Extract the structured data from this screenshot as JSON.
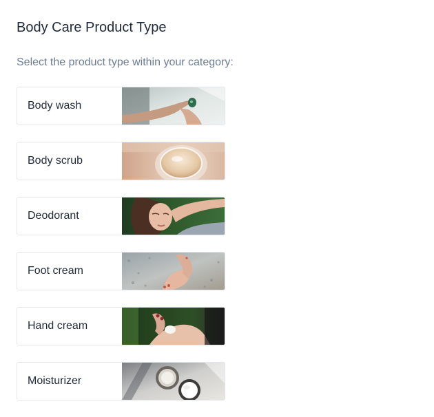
{
  "page": {
    "title": "Body Care Product Type",
    "subtitle": "Select the product type within your category:"
  },
  "options": [
    {
      "label": "Body wash",
      "image": "body-wash-photo"
    },
    {
      "label": "Body scrub",
      "image": "body-scrub-photo"
    },
    {
      "label": "Deodorant",
      "image": "deodorant-photo"
    },
    {
      "label": "Foot cream",
      "image": "foot-cream-photo"
    },
    {
      "label": "Hand cream",
      "image": "hand-cream-photo"
    },
    {
      "label": "Moisturizer",
      "image": "moisturizer-photo"
    }
  ]
}
